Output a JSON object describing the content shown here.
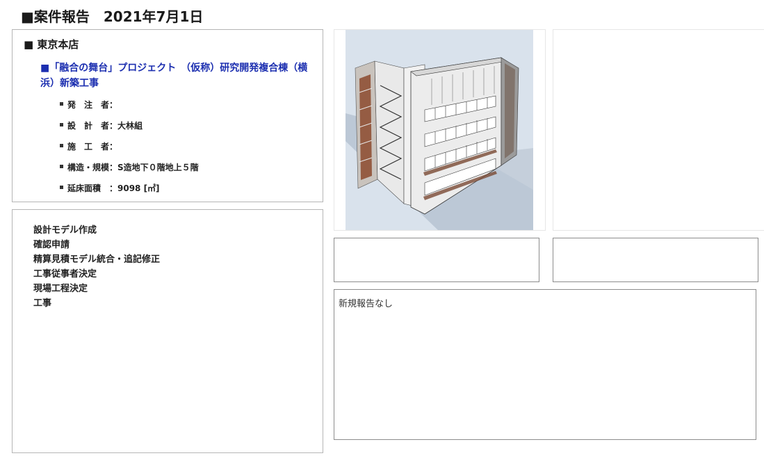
{
  "header": {
    "title": "■案件報告　2021年7月1日"
  },
  "branch": {
    "label": "■ 東京本店"
  },
  "project": {
    "name": "■「融合の舞台」プロジェクト　（仮称）研究開発複合棟（横浜）新築工事"
  },
  "details": [
    {
      "text": "発　注　者："
    },
    {
      "text": "設　計　者：大林組"
    },
    {
      "text": "施　工　者："
    },
    {
      "text": "構造・規模：S造地下０階地上５階"
    },
    {
      "text": "延床面積　：9098 [㎡]"
    }
  ],
  "steps": [
    "設計モデル作成",
    "確認申請",
    "精算見積モデル統合・追記修正",
    "工事従事者決定",
    "現場工程決定",
    "工事"
  ],
  "report": {
    "text": "新規報告なし"
  },
  "colors": {
    "project_link": "#1c2fb0",
    "border": "#b5b5b5"
  },
  "image": {
    "name": "building-3d-model-render"
  }
}
